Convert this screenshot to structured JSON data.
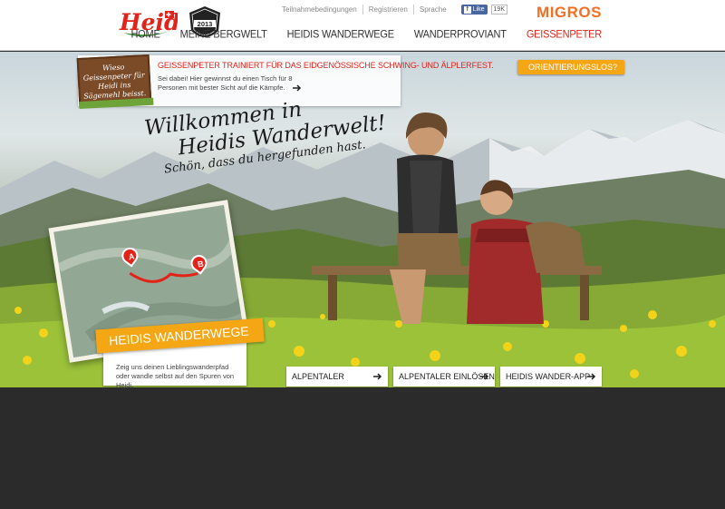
{
  "header": {
    "logo_text": "Heidi",
    "badge_year": "2013",
    "top_links": [
      "Teilnahmebedingungen",
      "Registrieren",
      "Sprache"
    ],
    "facebook": {
      "like_label": "Like",
      "count": "19K"
    },
    "brand": "MIGROS",
    "nav": [
      {
        "label": "HOME",
        "active": false
      },
      {
        "label": "MEINE BERGWELT",
        "active": false
      },
      {
        "label": "HEIDIS WANDERWEGE",
        "active": false
      },
      {
        "label": "WANDERPROVIANT",
        "active": false
      },
      {
        "label": "GEISSENPETER",
        "active": true
      }
    ]
  },
  "promo": {
    "sign_text": "Wieso Geissenpeter für Heidi ins Sägemehl beisst.",
    "title": "GEISSENPETER TRAINIERT FÜR DAS EIDGENÖSSISCHE SCHWING- UND ÄLPLERFEST.",
    "text": "Sei dabei! Hier gewinnst du einen Tisch für 8 Personen mit bester Sicht auf die Kämpfe."
  },
  "orientation_button": "ORIENTIERUNGSLOS?",
  "welcome": {
    "line1": "Willkommen in",
    "line2": "Heidis Wanderwelt!",
    "line3": "Schön, dass du hergefunden hast."
  },
  "map": {
    "pin_a": "A",
    "pin_b": "B"
  },
  "wanderwege": {
    "title": "HEIDIS WANDERWEGE",
    "text": "Zeig uns deinen Lieblingswanderpfad oder wandle selbst auf den Spuren von Heidi."
  },
  "ctas": [
    "ALPENTALER HINZUFÜGEN",
    "ALPENTALER EINLÖSEN",
    "HEIDIS WANDER-APP"
  ],
  "colors": {
    "accent_red": "#e2231a",
    "accent_orange": "#f5a614",
    "migros_orange": "#f36f21",
    "dark_bg": "#2b2b2b"
  }
}
